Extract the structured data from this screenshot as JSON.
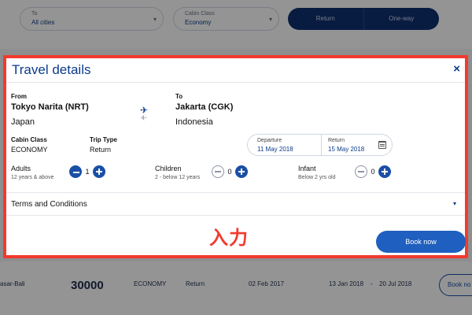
{
  "background": {
    "to_select": {
      "label": "To",
      "value": "All cities"
    },
    "cabin_select": {
      "label": "Cabin Class",
      "value": "Economy"
    },
    "trip_toggle": [
      "Return",
      "One-way"
    ],
    "result_row": {
      "route": "asar-Bali",
      "price": "30000",
      "cabin": "ECONOMY",
      "trip": "Return",
      "date": "02 Feb 2017",
      "period_start": "13 Jan 2018",
      "period_sep": "-",
      "period_end": "20 Jul 2018",
      "button": "Book no"
    }
  },
  "modal": {
    "title": "Travel details",
    "close_glyph": "×",
    "from": {
      "label": "From",
      "city": "Tokyo Narita (NRT)",
      "country": "Japan"
    },
    "to": {
      "label": "To",
      "city": "Jakarta (CGK)",
      "country": "Indonesia"
    },
    "cabin": {
      "label": "Cabin Class",
      "value": "ECONOMY"
    },
    "trip_type": {
      "label": "Trip Type",
      "value": "Return"
    },
    "departure": {
      "label": "Departure",
      "value": "11 May 2018"
    },
    "return": {
      "label": "Return",
      "value": "15 May 2018"
    },
    "passengers": [
      {
        "title": "Adults",
        "sub": "12 years & above",
        "count": "1"
      },
      {
        "title": "Children",
        "sub": "2 - below 12 years",
        "count": "0"
      },
      {
        "title": "Infant",
        "sub": "Below 2 yrs old",
        "count": "0"
      }
    ],
    "terms": "Terms and Conditions",
    "annotation": "入力",
    "book_button": "Book now"
  },
  "colors": {
    "accent": "#1a4fa5",
    "title": "#0b3b8c",
    "highlight_border": "#f23a2e"
  }
}
